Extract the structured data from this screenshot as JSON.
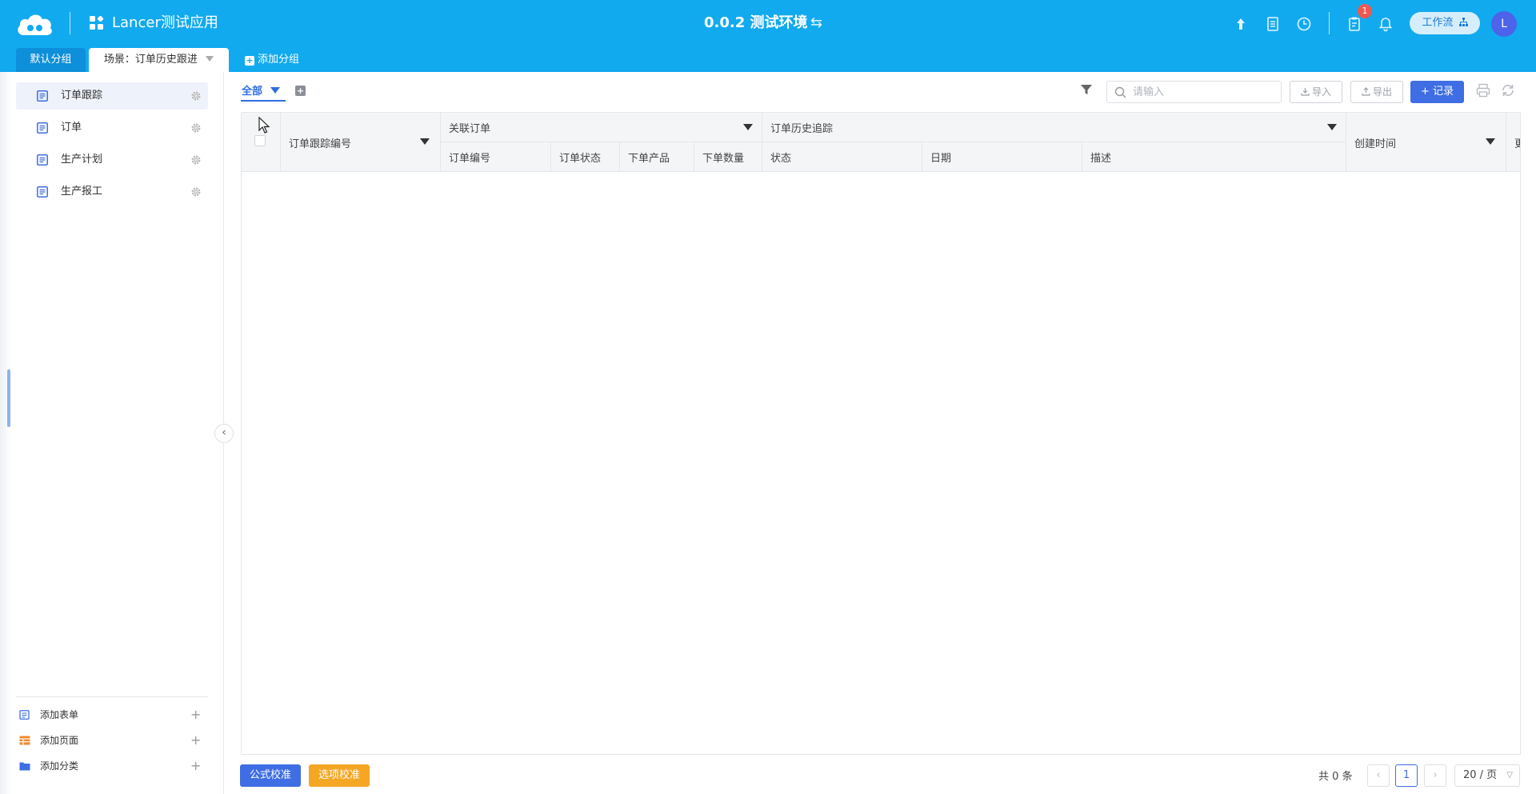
{
  "header": {
    "app_title": "Lancer测试应用",
    "env_title": "0.0.2 测试环境",
    "env_switch_glyph": "⇆",
    "notification_badge": "1",
    "workflow_label": "工作流",
    "avatar_letter": "L"
  },
  "groups": {
    "default_label": "默认分组",
    "active_label": "场景：订单历史跟进",
    "add_label": "添加分组"
  },
  "sidebar": {
    "items": [
      {
        "label": "订单跟踪",
        "active": true
      },
      {
        "label": "订单",
        "active": false
      },
      {
        "label": "生产计划",
        "active": false
      },
      {
        "label": "生产报工",
        "active": false
      }
    ],
    "footer": [
      {
        "label": "添加表单",
        "icon": "form-icon"
      },
      {
        "label": "添加页面",
        "icon": "page-icon"
      },
      {
        "label": "添加分类",
        "icon": "folder-icon"
      }
    ]
  },
  "toolbar": {
    "view_label": "全部",
    "search_placeholder": "请输入",
    "import_label": "导入",
    "export_label": "导出",
    "add_record_label": "+ 记录"
  },
  "table": {
    "col_tracking_no": "订单跟踪编号",
    "group_related_order": "关联订单",
    "col_order_no": "订单编号",
    "col_order_status": "订单状态",
    "col_order_product": "下单产品",
    "col_order_qty": "下单数量",
    "group_history": "订单历史追踪",
    "col_status": "状态",
    "col_date": "日期",
    "col_desc": "描述",
    "col_created": "创建时间",
    "col_clipped": "更"
  },
  "footer": {
    "formula_check": "公式校准",
    "option_check": "选项校准",
    "total": "共 0 条",
    "current_page": "1",
    "prev": "‹",
    "next": "›",
    "page_size": "20 / 页"
  },
  "colors": {
    "header_bg": "#12aaef",
    "primary": "#3e6de4",
    "warning": "#f5a623",
    "badge": "#f0584f"
  }
}
